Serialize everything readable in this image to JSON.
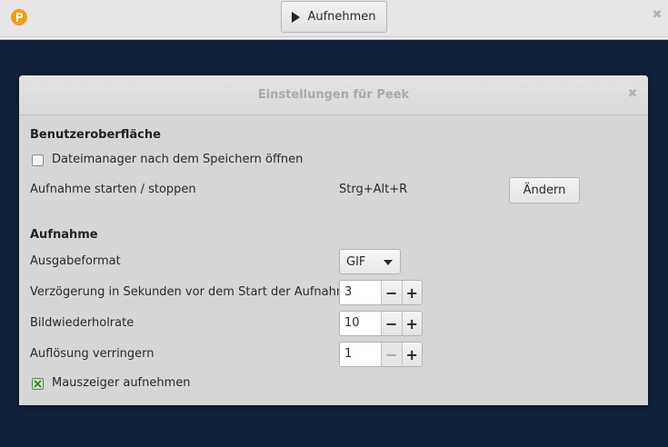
{
  "topbar": {
    "logo_icon": "peek-logo-icon",
    "record_label": "Aufnehmen",
    "record_icon": "play-icon",
    "close_icon": "close-icon",
    "close_glyph": "✖"
  },
  "dialog": {
    "title": "Einstellungen für Peek",
    "close_glyph": "✖",
    "ui_section": {
      "title": "Benutzeroberfläche",
      "open_filemanager": {
        "label": "Dateimanager nach dem Speichern öffnen",
        "checked": false
      },
      "shortcut": {
        "label": "Aufnahme starten / stoppen",
        "value": "Strg+Alt+R",
        "button_label": "Ändern"
      }
    },
    "recording_section": {
      "title": "Aufnahme",
      "output_format": {
        "label": "Ausgabeformat",
        "value": "GIF"
      },
      "delay": {
        "label": "Verzögerung in Sekunden vor dem Start der Aufnahme",
        "value": "3"
      },
      "framerate": {
        "label": "Bildwiederholrate",
        "value": "10"
      },
      "downsample": {
        "label": "Auflösung verringern",
        "value": "1",
        "minus_disabled": true
      },
      "capture_mouse": {
        "label": "Mauszeiger aufnehmen",
        "checked": true
      }
    },
    "spin_minus": "−",
    "spin_plus": "+"
  },
  "colors": {
    "background": "#12213a",
    "logo": "#f39c12",
    "dialog_bg": "#d6d6d6"
  }
}
